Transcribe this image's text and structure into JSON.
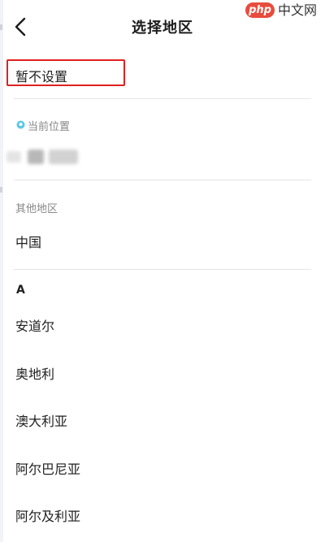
{
  "header": {
    "title": "选择地区",
    "back_icon": "chevron-left-icon"
  },
  "watermark": {
    "logo_text": "php",
    "site_text": "中文网"
  },
  "unset_option": {
    "label": "暂不设置",
    "highlight_color": "#e02020"
  },
  "current_location": {
    "label": "当前位置",
    "icon": "location-pin-icon",
    "icon_color": "#5ac8e6"
  },
  "other_regions": {
    "label": "其他地区",
    "items": [
      "中国"
    ]
  },
  "alphabet_section": {
    "letter": "A",
    "items": [
      "安道尔",
      "奥地利",
      "澳大利亚",
      "阿尔巴尼亚",
      "阿尔及利亚"
    ]
  }
}
